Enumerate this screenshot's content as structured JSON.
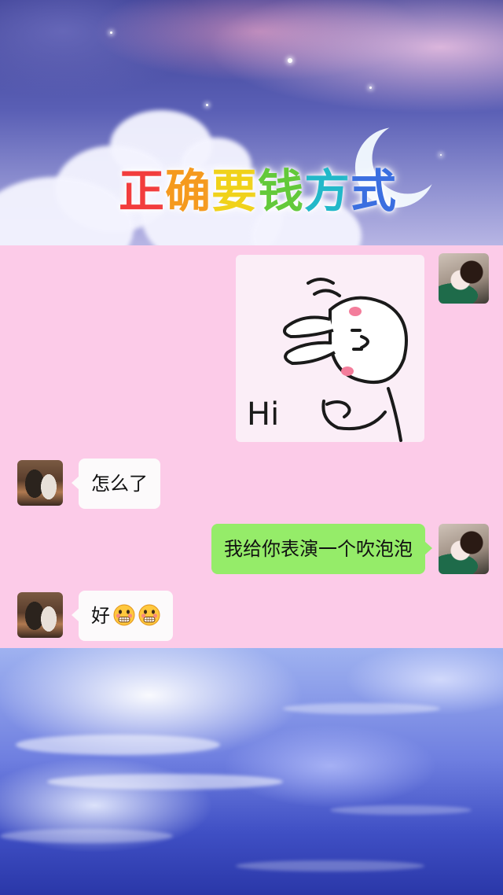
{
  "headline": {
    "text": "正确要钱方式",
    "chars": [
      {
        "c": "正",
        "color": "#f23d3d"
      },
      {
        "c": "确",
        "color": "#f59a1e"
      },
      {
        "c": "要",
        "color": "#f0d21a"
      },
      {
        "c": "钱",
        "color": "#63c93a"
      },
      {
        "c": "方",
        "color": "#22b8c9"
      },
      {
        "c": "式",
        "color": "#3b6fe0"
      }
    ]
  },
  "chat": {
    "sticker": {
      "caption": "Hi",
      "icon": "bunny-sticker"
    },
    "messages": [
      {
        "side": "left",
        "text": "怎么了"
      },
      {
        "side": "right",
        "text": "我给你表演一个吹泡泡"
      },
      {
        "side": "left",
        "text": "好",
        "emoji": [
          "grimace-emoji",
          "grimace-emoji"
        ]
      }
    ]
  },
  "colors": {
    "chat_background": "#fccbe8",
    "incoming_bubble": "#fcfafb",
    "outgoing_bubble": "#95ec69"
  }
}
